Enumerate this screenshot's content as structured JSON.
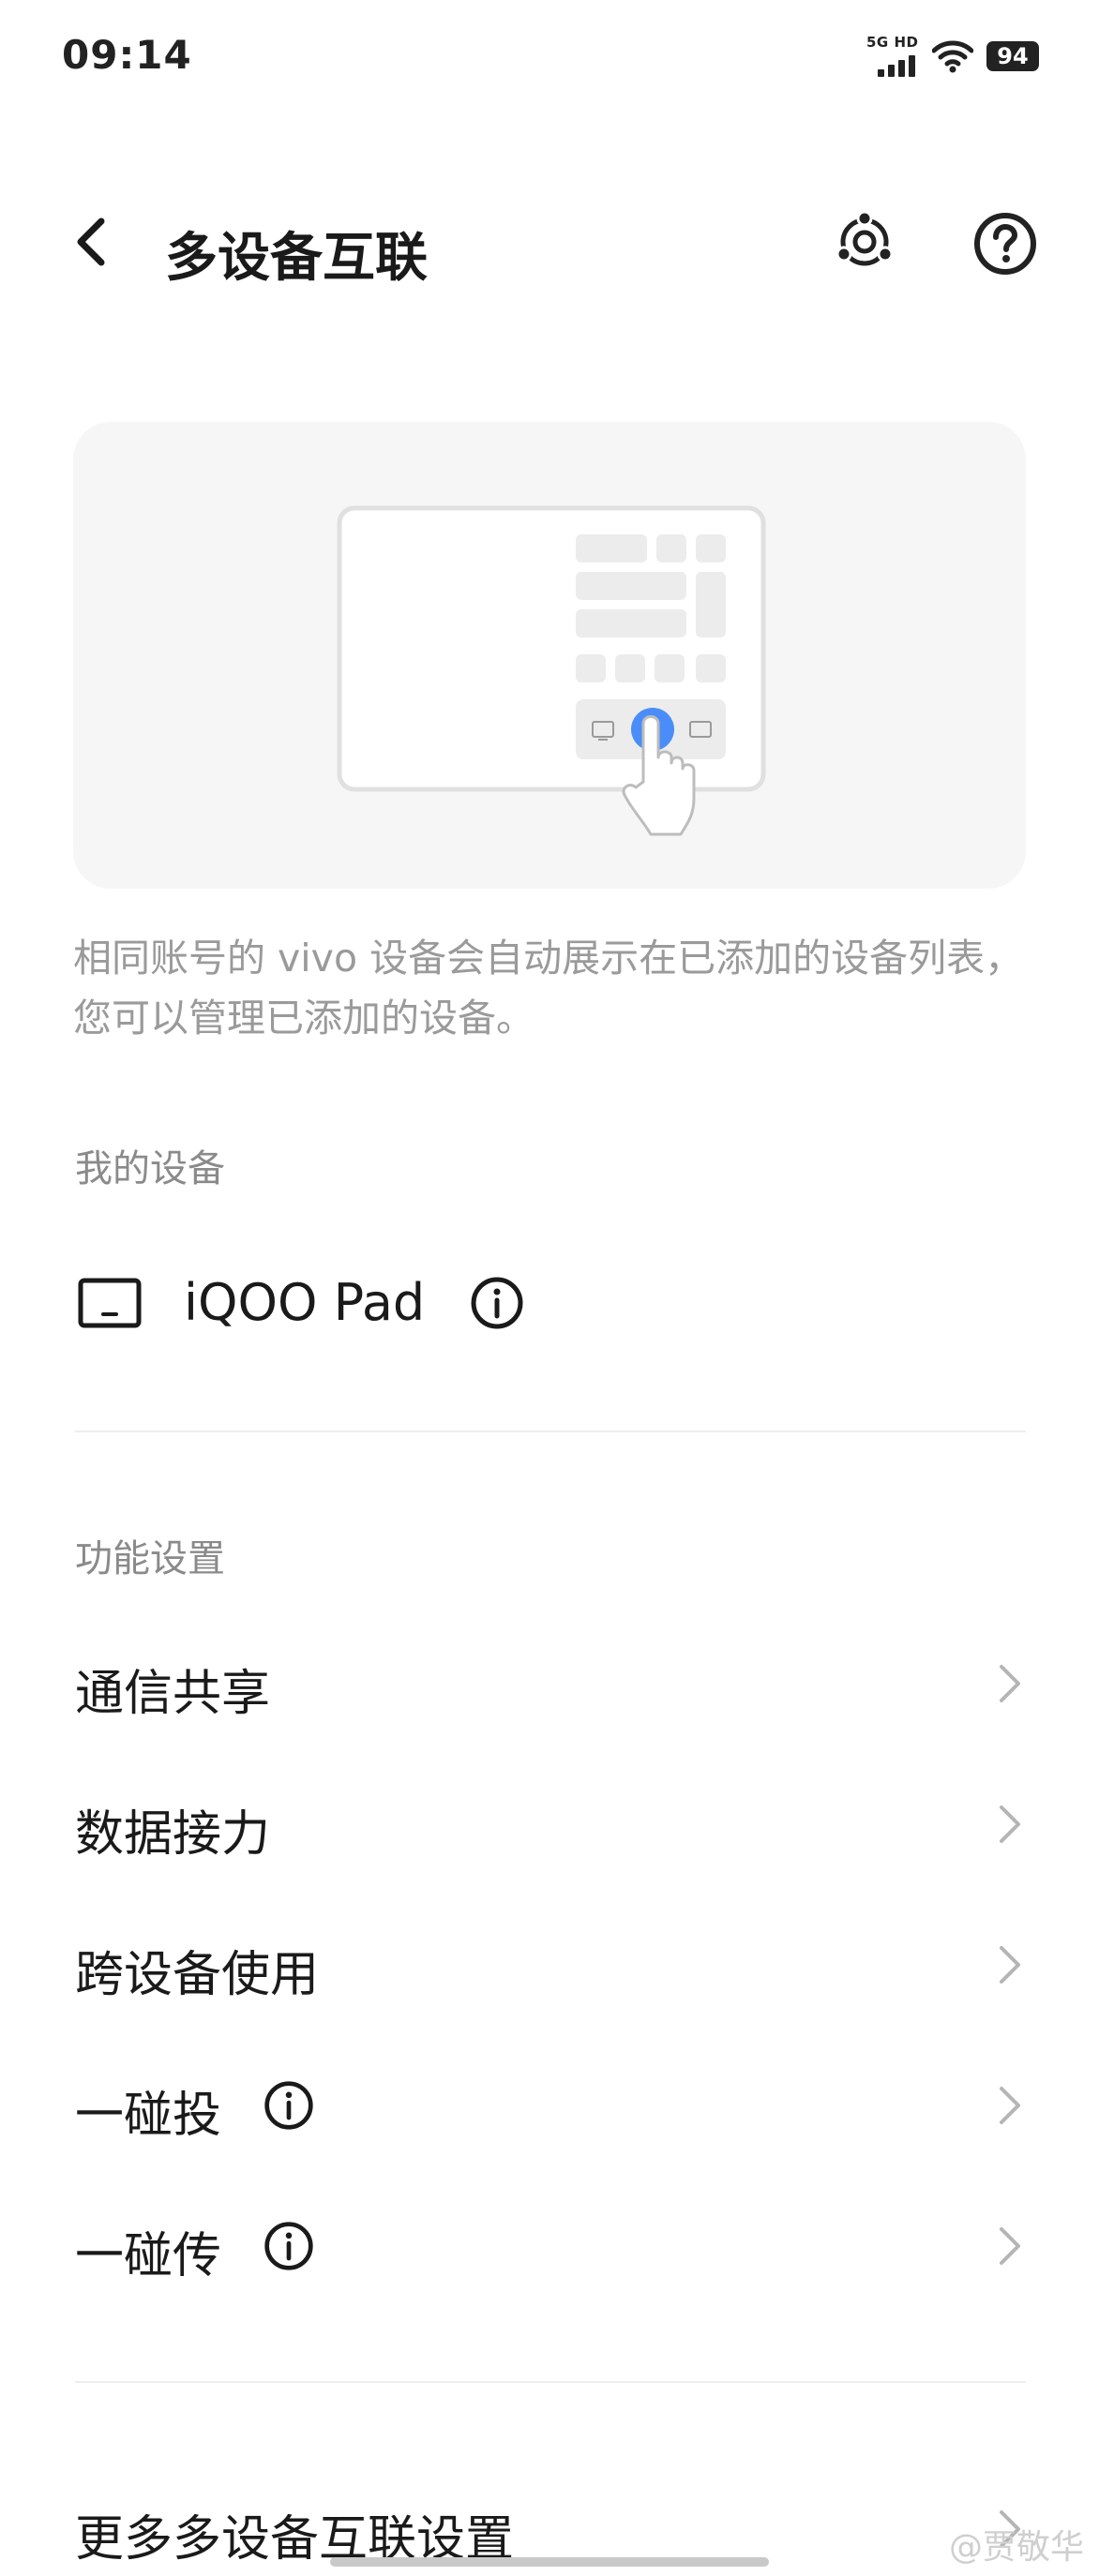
{
  "status_bar": {
    "time": "09:14",
    "network": "5G HD",
    "battery": "94"
  },
  "header": {
    "title": "多设备互联",
    "back_icon": "chevron-left-icon",
    "connect_icon": "multi-device-connect-icon",
    "help_icon": "question-circle-icon"
  },
  "description": "相同账号的 vivo 设备会自动展示在已添加的设备列表，您可以管理已添加的设备。",
  "my_devices": {
    "section_title": "我的设备",
    "items": [
      {
        "name": "iQOO Pad",
        "icon": "tablet-icon",
        "info_icon": "info-icon"
      }
    ]
  },
  "features": {
    "section_title": "功能设置",
    "items": [
      {
        "label": "通信共享"
      },
      {
        "label": "数据接力"
      },
      {
        "label": "跨设备使用"
      },
      {
        "label": "一碰投",
        "info": true
      },
      {
        "label": "一碰传",
        "info": true
      }
    ]
  },
  "more": {
    "label": "更多多设备互联设置"
  },
  "watermark": "@贾敬华",
  "colors": {
    "accent": "#4b8df8",
    "text": "#1a1a1a",
    "secondary": "#8a8a8a",
    "card_bg": "#f6f6f6"
  }
}
